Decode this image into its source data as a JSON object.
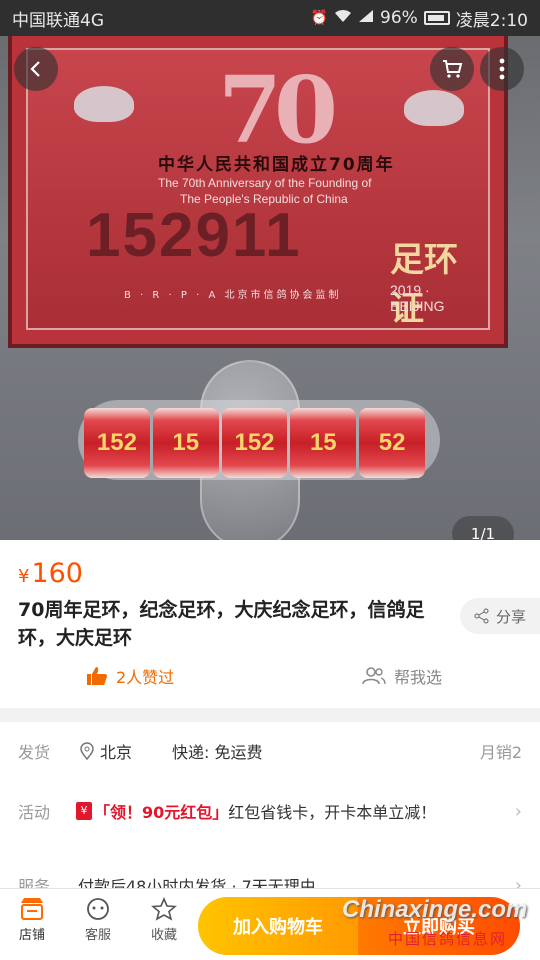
{
  "status_bar": {
    "carrier": "中国联通4G",
    "battery": "96%",
    "time": "凌晨2:10"
  },
  "hero": {
    "emblem": "70",
    "cert_title": "中华人民共和国成立70周年",
    "cert_en_line1": "The 70th Anniversary of the Founding of",
    "cert_en_line2": "The People's Republic of China",
    "cert_number": "152911",
    "cert_label": "足环证",
    "cert_sub": "B · R · P · A  北京市信鸽协会监制",
    "cert_year": "2019 · BEIJING",
    "ring_texts": [
      "152",
      "15",
      "152",
      "15",
      "52"
    ],
    "pager": "1/1"
  },
  "product": {
    "currency": "¥",
    "price": "160",
    "title": "70周年足环，纪念足环，大庆纪念足环，信鸽足环，大庆足环",
    "share_label": "分享",
    "likes_text": "2人赞过",
    "help_choose": "帮我选"
  },
  "details": {
    "shipping_label": "发货",
    "shipping_location": "北京",
    "shipping_fee": "快递: 免运费",
    "monthly_sales": "月销2",
    "promo_label": "活动",
    "promo_tag": "「领！90元红包」",
    "promo_text": "红包省钱卡，开卡本单立减！",
    "service_label": "服务",
    "service_text": "付款后48小时内发货 · 7天无理由"
  },
  "bottom_bar": {
    "store": "店铺",
    "service": "客服",
    "favorite": "收藏",
    "add_to_cart": "加入购物车",
    "buy_now": "立即购买"
  },
  "watermark": {
    "site": "Chinaxinge.com",
    "site_cn": "中国信鸽信息网"
  },
  "colors": {
    "price": "#ff5000",
    "cart_button": "#ffb000",
    "buy_button": "#ff5a00"
  }
}
